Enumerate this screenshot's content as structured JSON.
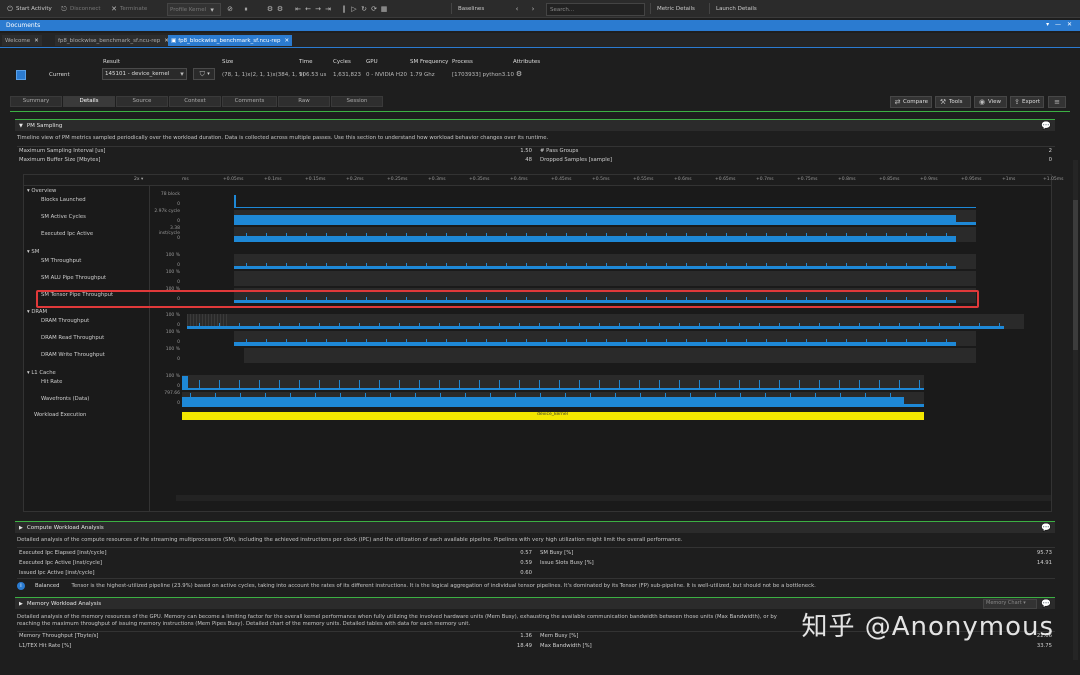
{
  "toolbar": {
    "start_activity": "Start Activity",
    "disconnect": "Disconnect",
    "terminate": "Terminate",
    "profile_kernel": "Profile Kernel",
    "baselines": "Baselines",
    "search_placeholder": "Search...",
    "metric_details": "Metric Details",
    "launch_details": "Launch Details"
  },
  "documents": {
    "title": "Documents"
  },
  "tabs": [
    {
      "label": "Welcome"
    },
    {
      "label": "fp8_blockwise_benchmark_sf.ncu-rep"
    },
    {
      "label": "fp8_blockwise_benchmark_sf.ncu-rep"
    }
  ],
  "result": {
    "current_label": "Current",
    "result_label": "Result",
    "result_value": "145101 - device_kernel",
    "size_label": "Size",
    "size_value": "(78, 1, 1)x(2, 1, 1)x(384, 1, 1)",
    "time_label": "Time",
    "time_value": "906.53 us",
    "cycles_label": "Cycles",
    "cycles_value": "1,631,823",
    "gpu_label": "GPU",
    "gpu_value": "0 - NVIDIA H20",
    "smfreq_label": "SM Frequency",
    "smfreq_value": "1.79 Ghz",
    "process_label": "Process",
    "process_value": "[1703933] python3.10",
    "attributes_label": "Attributes"
  },
  "subtabs": [
    "Summary",
    "Details",
    "Source",
    "Context",
    "Comments",
    "Raw",
    "Session"
  ],
  "actions": {
    "compare": "Compare",
    "tools": "Tools",
    "view": "View",
    "export": "Export"
  },
  "pm": {
    "title": "PM Sampling",
    "desc": "Timeline view of PM metrics sampled periodically over the workload duration. Data is collected across multiple passes. Use this section to understand how workload behavior changes over its runtime.",
    "max_interval_label": "Maximum Sampling Interval [us]",
    "max_interval_value": "1.50",
    "max_buffer_label": "Maximum Buffer Size [Mbytes]",
    "max_buffer_value": "48",
    "pass_groups_label": "# Pass Groups",
    "pass_groups_value": "2",
    "dropped_label": "Dropped Samples [sample]",
    "dropped_value": "0",
    "zoom": "2x",
    "ticks": [
      "ms",
      "+0.05ms",
      "+0.1ms",
      "+0.15ms",
      "+0.2ms",
      "+0.25ms",
      "+0.3ms",
      "+0.35ms",
      "+0.4ms",
      "+0.45ms",
      "+0.5ms",
      "+0.55ms",
      "+0.6ms",
      "+0.65ms",
      "+0.7ms",
      "+0.75ms",
      "+0.8ms",
      "+0.85ms",
      "+0.9ms",
      "+0.95ms",
      "+1ms",
      "+1.05ms"
    ],
    "groups": {
      "overview": "Overview",
      "sm": "SM",
      "dram": "DRAM",
      "l1": "L1 Cache"
    },
    "rows": {
      "blocks": "Blocks Launched",
      "blocks_max": "78 block",
      "sm_active": "SM Active Cycles",
      "sm_active_max": "2.97k cycle",
      "ipc": "Executed Ipc Active",
      "ipc_max": "3.38 inst/cycle",
      "sm_thr": "SM Throughput",
      "alu": "SM ALU Pipe Throughput",
      "tensor": "SM Tensor Pipe Throughput",
      "dram_thr": "DRAM Throughput",
      "dram_read": "DRAM Read Throughput",
      "dram_write": "DRAM Write Throughput",
      "hit": "Hit Rate",
      "wave": "Wavefronts (Data)",
      "wave_max": "797.66",
      "workload": "Workload Execution",
      "workload_bar": "device_kernel",
      "pct": "100 %",
      "zero": "0"
    }
  },
  "cwa": {
    "title": "Compute Workload Analysis",
    "desc": "Detailed analysis of the compute resources of the streaming multiprocessors (SM), including the achieved instructions per clock (IPC) and the utilization of each available pipeline. Pipelines with very high utilization might limit the overall performance.",
    "m1_label": "Executed Ipc Elapsed [inst/cycle]",
    "m1_value": "0.57",
    "m2_label": "Executed Ipc Active [inst/cycle]",
    "m2_value": "0.59",
    "m3_label": "Issued Ipc Active [inst/cycle]",
    "m3_value": "0.60",
    "m4_label": "SM Busy [%]",
    "m4_value": "95.73",
    "m5_label": "Issue Slots Busy [%]",
    "m5_value": "14.91",
    "balanced": "Balanced",
    "note": "Tensor is the highest-utilized pipeline (23.9%) based on active cycles, taking into account the rates of its different instructions. It is the logical aggregation of individual tensor pipelines. It's dominated by its Tensor (FP) sub-pipeline. It is well-utilized, but should not be a bottleneck."
  },
  "mwa": {
    "title": "Memory Workload Analysis",
    "dropdown": "Memory Chart",
    "desc": "Detailed analysis of the memory resources of the GPU. Memory can become a limiting factor for the overall kernel performance when fully utilizing the involved hardware units (Mem Busy), exhausting the available communication bandwidth between those units (Max Bandwidth), or by reaching the maximum throughput of issuing memory instructions (Mem Pipes Busy). Detailed chart of the memory units. Detailed tables with data for each memory unit.",
    "m1_label": "Memory Throughput [Tbyte/s]",
    "m1_value": "1.36",
    "m2_label": "L1/TEX Hit Rate [%]",
    "m2_value": "18.49",
    "m3_label": "Mem Busy [%]",
    "m3_value": "22.06",
    "m4_label": "Max Bandwidth [%]",
    "m4_value": "33.75"
  },
  "watermark": "知乎 @Anonymous",
  "colors": {
    "accent": "#2b7bd0",
    "series": "#1e88d6",
    "workload": "#f3e600",
    "highlight": "#e0393a",
    "section_line": "#3cb043"
  }
}
